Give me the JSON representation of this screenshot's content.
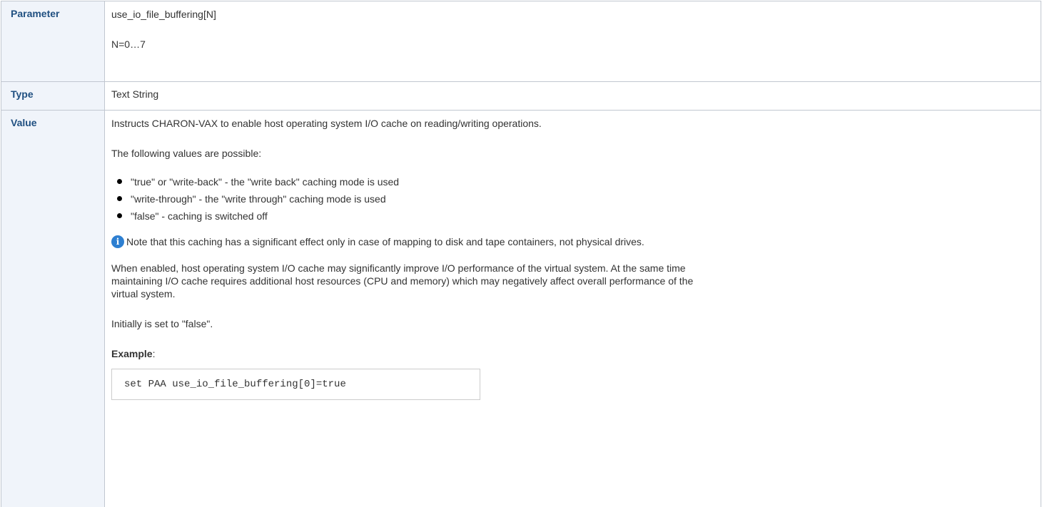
{
  "table": {
    "parameter": {
      "header": "Parameter",
      "name": "use_io_file_buffering[N]",
      "range": "N=0…7"
    },
    "type": {
      "header": "Type",
      "value": "Text String"
    },
    "value": {
      "header": "Value",
      "description": "Instructs CHARON-VAX to enable host operating system I/O cache on reading/writing operations.",
      "values_intro": "The following values are possible:",
      "options": [
        "\"true\" or \"write-back\" - the \"write back\" caching mode is used",
        "\"write-through\" - the \"write through\" caching mode is used",
        "\"false\" - caching is switched off"
      ],
      "note_icon": "info-icon",
      "note": "Note that this caching has a significant effect only in case of mapping to disk and tape containers, not physical drives.",
      "performance_line1": "When enabled, host operating system I/O cache may significantly improve I/O performance of the virtual system. At the same time",
      "performance_line2": "maintaining I/O cache requires additional host resources (CPU and memory) which may negatively affect overall performance of the",
      "performance_line3": "virtual system.",
      "initial": "Initially is set to \"false\".",
      "example_label": "Example",
      "example_colon": ":",
      "example_code": "set PAA use_io_file_buffering[0]=true"
    }
  }
}
